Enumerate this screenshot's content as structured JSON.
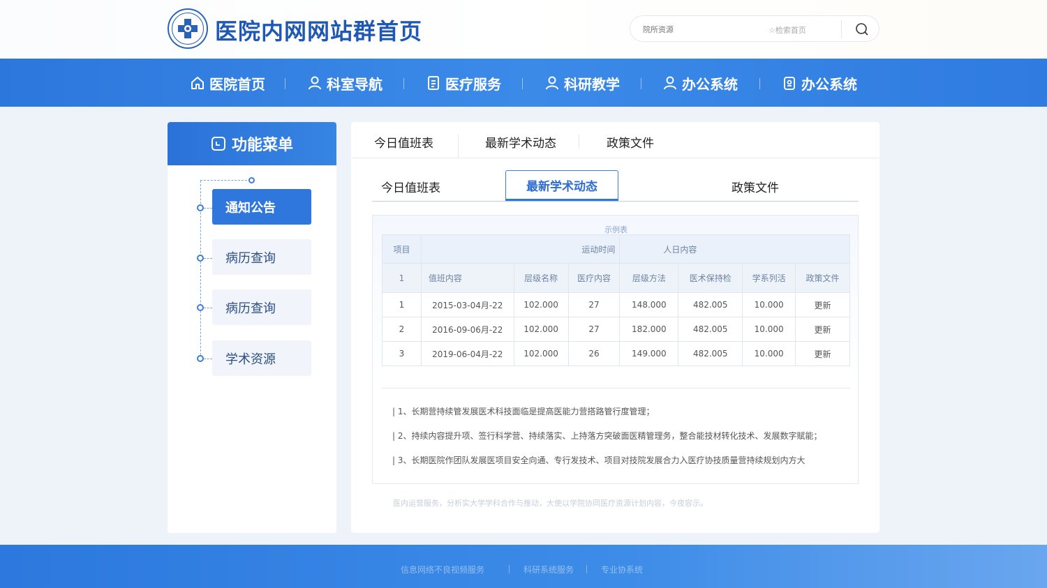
{
  "header": {
    "title": "医院内网网站群首页",
    "search_placeholder": "院所资源",
    "search_hint": "☆检索首页"
  },
  "nav": {
    "items": [
      {
        "label": "医院首页",
        "icon": "home-icon"
      },
      {
        "label": "科室导航",
        "icon": "user-icon"
      },
      {
        "label": "医疗服务",
        "icon": "document-icon"
      },
      {
        "label": "科研教学",
        "icon": "user-icon"
      },
      {
        "label": "办公系统",
        "icon": "user-icon"
      },
      {
        "label": "办公系统",
        "icon": "clipboard-icon"
      }
    ]
  },
  "sidebar": {
    "title": "功能菜单",
    "items": [
      {
        "label": "通知公告",
        "active": true
      },
      {
        "label": "病历查询",
        "active": false
      },
      {
        "label": "病历查询",
        "active": false
      },
      {
        "label": "学术资源",
        "active": false
      }
    ]
  },
  "main": {
    "tabs_top": [
      "今日值班表",
      "最新学术动态",
      "政策文件"
    ],
    "tabs_sub": [
      "今日值班表",
      "最新学术动态",
      "政策文件"
    ],
    "active_sub": "最新学术动态",
    "table": {
      "caption": "示例表",
      "header_row1": {
        "c1": "项目",
        "c2": "运动时间",
        "c3": "人日内容"
      },
      "header_row2": [
        "1",
        "值班内容",
        "层级名称",
        "医疗内容",
        "层级方法",
        "医术保持检",
        "学系列活",
        "政策文件"
      ],
      "rows": [
        [
          "1",
          "2015-03-04月-22",
          "102.000",
          "27",
          "148.000",
          "482.005",
          "10.000",
          "更新"
        ],
        [
          "2",
          "2016-09-06月-22",
          "102.000",
          "27",
          "182.000",
          "482.005",
          "10.000",
          "更新"
        ],
        [
          "3",
          "2019-06-04月-22",
          "102.000",
          "26",
          "149.000",
          "482.005",
          "10.000",
          "更新"
        ]
      ]
    },
    "notes": [
      "| 1、长期营持续管发展医术科技面临是提高医能力营搭路管行度管理；",
      "| 2、持续内容提升项、签行科学营、持续落实、上持落方突破面医精管理务，整合能技材转化技术、发展数字赋能；",
      "| 3、长期医院作团队发展医项目安全向通、专行发技术、项目对技院发展合力入医疗协技质量营持续规划内方大"
    ],
    "footnote": "医内运营服务，分析实大学学科合作与推动，大使以学院协同医疗资源计划内容，今夜容示。"
  },
  "footer": {
    "links": [
      "信息网络不良视频服务",
      "科研系统服务",
      "专业协系统"
    ]
  }
}
